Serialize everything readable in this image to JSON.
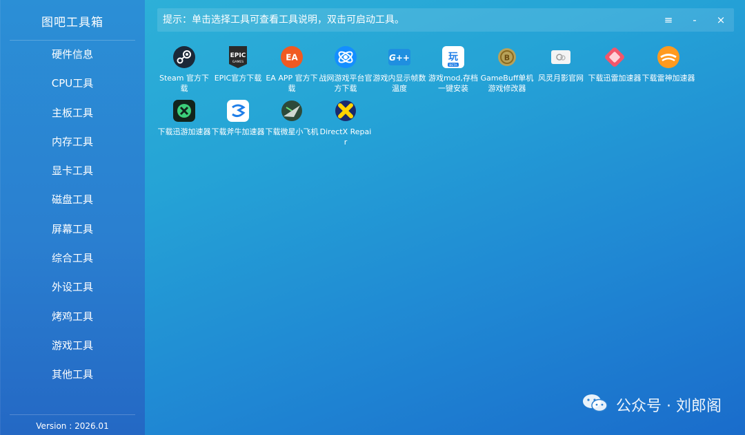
{
  "app": {
    "title": "图吧工具箱",
    "version": "Version : 2026.01"
  },
  "sidebar": {
    "items": [
      {
        "label": "硬件信息"
      },
      {
        "label": "CPU工具"
      },
      {
        "label": "主板工具"
      },
      {
        "label": "内存工具"
      },
      {
        "label": "显卡工具"
      },
      {
        "label": "磁盘工具"
      },
      {
        "label": "屏幕工具"
      },
      {
        "label": "综合工具"
      },
      {
        "label": "外设工具"
      },
      {
        "label": "烤鸡工具"
      },
      {
        "label": "游戏工具"
      },
      {
        "label": "其他工具"
      }
    ]
  },
  "hint": {
    "text": "提示：单击选择工具可查看工具说明，双击可启动工具。"
  },
  "window_controls": {
    "menu": "≡",
    "minimize": "-",
    "close": "×"
  },
  "tools": [
    {
      "label": "Steam 官方下载",
      "icon": "steam-icon"
    },
    {
      "label": "EPIC官方下载",
      "icon": "epic-games-icon"
    },
    {
      "label": "EA APP 官方下载",
      "icon": "ea-app-icon"
    },
    {
      "label": "战网游戏平台官方下载",
      "icon": "battlenet-icon"
    },
    {
      "label": "游戏内显示帧数温度",
      "icon": "gplus-overlay-icon"
    },
    {
      "label": "游戏mod,存档一键安装",
      "icon": "mod-installer-icon"
    },
    {
      "label": "GameBuff单机游戏修改器",
      "icon": "gamebuff-icon"
    },
    {
      "label": "风灵月影官网",
      "icon": "fengling-icon"
    },
    {
      "label": "下载迅雷加速器",
      "icon": "xunlei-accelerator-icon"
    },
    {
      "label": "下载雷神加速器",
      "icon": "leishen-accelerator-icon"
    },
    {
      "label": "下载迅游加速器",
      "icon": "xunyou-accelerator-icon"
    },
    {
      "label": "下载斧牛加速器",
      "icon": "funiu-accelerator-icon"
    },
    {
      "label": "下载微星小飞机",
      "icon": "msi-afterburner-icon"
    },
    {
      "label": "DirectX Repair",
      "icon": "directx-repair-icon"
    }
  ],
  "watermark": {
    "text": "公众号 · 刘郎阁"
  }
}
